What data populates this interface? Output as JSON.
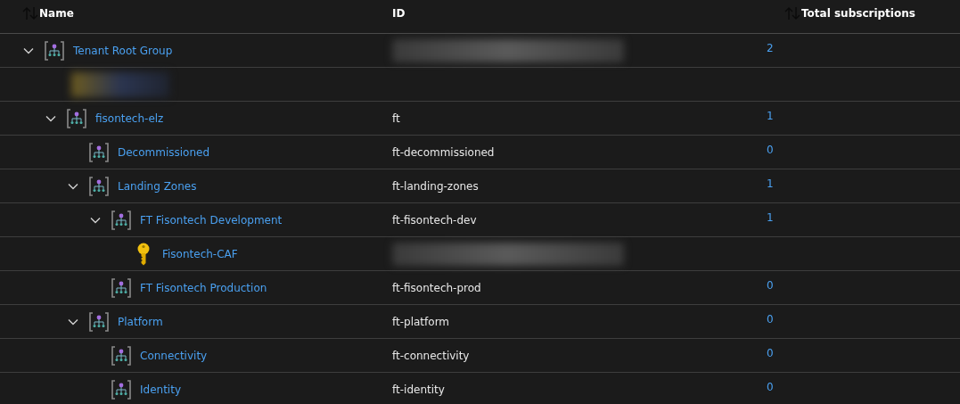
{
  "columns": [
    {
      "label": "Name",
      "sortable": true
    },
    {
      "label": "ID",
      "sortable": false
    },
    {
      "label": "Total subscriptions",
      "sortable": true
    }
  ],
  "tree": [
    {
      "kind": "group",
      "name": "Tenant Root Group",
      "id_hidden": true,
      "count": "2",
      "expanded": true,
      "children": [
        {
          "kind": "hidden"
        },
        {
          "kind": "group",
          "name": "fisontech-elz",
          "id": "ft",
          "count": "1",
          "expanded": true,
          "children": [
            {
              "kind": "group",
              "name": "Decommissioned",
              "id": "ft-decommissioned",
              "count": "0"
            },
            {
              "kind": "group",
              "name": "Landing Zones",
              "id": "ft-landing-zones",
              "count": "1",
              "expanded": true,
              "children": [
                {
                  "kind": "group",
                  "name": "FT Fisontech Development",
                  "id": "ft-fisontech-dev",
                  "count": "1",
                  "expanded": true,
                  "children": [
                    {
                      "kind": "subscription",
                      "name": "Fisontech-CAF",
                      "id_hidden": true
                    }
                  ]
                },
                {
                  "kind": "group",
                  "name": "FT Fisontech Production",
                  "id": "ft-fisontech-prod",
                  "count": "0"
                }
              ]
            },
            {
              "kind": "group",
              "name": "Platform",
              "id": "ft-platform",
              "count": "0",
              "expanded": true,
              "children": [
                {
                  "kind": "group",
                  "name": "Connectivity",
                  "id": "ft-connectivity",
                  "count": "0"
                },
                {
                  "kind": "group",
                  "name": "Identity",
                  "id": "ft-identity",
                  "count": "0"
                }
              ]
            }
          ]
        }
      ]
    }
  ]
}
